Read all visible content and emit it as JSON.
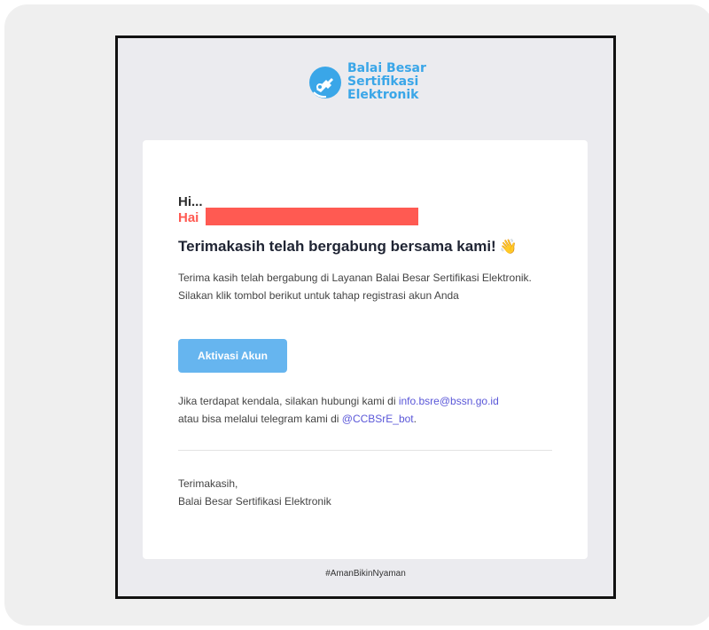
{
  "logo": {
    "line1": "Balai Besar",
    "line2": "Sertifikasi",
    "line3": "Elektronik",
    "icon": "bsre-key-icon",
    "color": "#3aa6e8"
  },
  "email": {
    "greeting": "Hi...",
    "hai": "Hai",
    "heading": "Terimakasih telah bergabung bersama kami!",
    "wave_emoji": "👋",
    "body": "Terima kasih telah bergabung di Layanan Balai Besar Sertifikasi Elektronik. Silakan klik tombol berikut untuk tahap registrasi akun Anda",
    "button_label": "Aktivasi Akun",
    "contact_prefix": "Jika terdapat kendala, silakan hubungi kami di",
    "contact_email": "info.bsre@bssn.go.id",
    "contact_mid": "atau bisa melalui telegram kami di",
    "telegram": "@CCBSrE_bot",
    "contact_suffix": ".",
    "signoff_line1": "Terimakasih,",
    "signoff_line2": "Balai Besar Sertifikasi Elektronik",
    "footer_tag": "#AmanBikinNyaman"
  },
  "colors": {
    "accent": "#66b5ef",
    "highlight": "#ff5a52",
    "link": "#5a57d8"
  }
}
